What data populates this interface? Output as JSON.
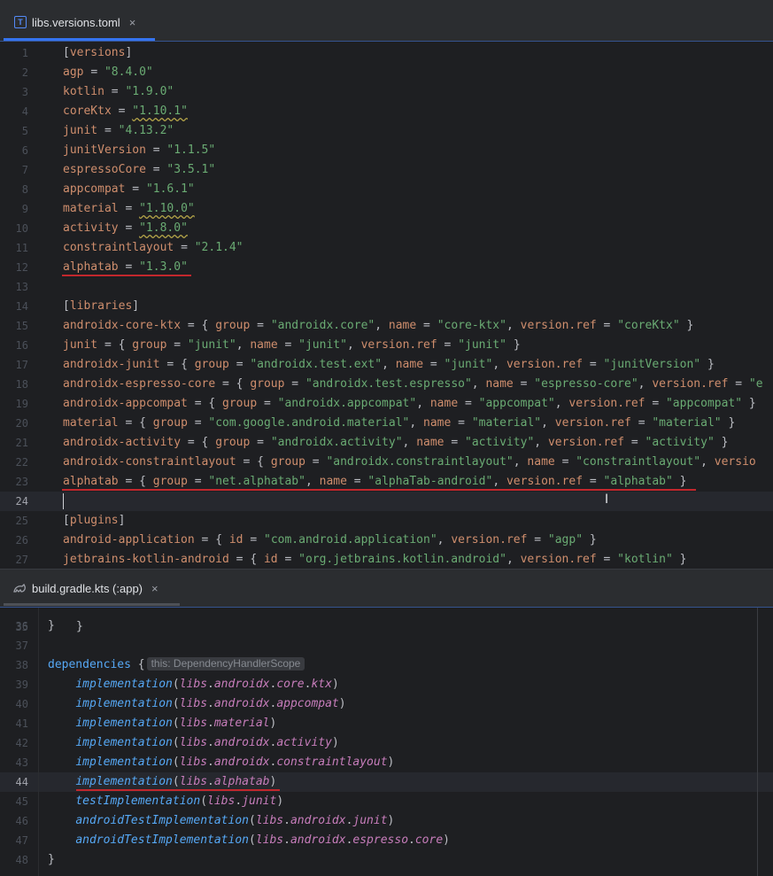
{
  "top_tab": {
    "label": "libs.versions.toml",
    "icon": "toml-file-icon",
    "close": "×"
  },
  "bottom_tab": {
    "label": "build.gradle.kts (:app)",
    "icon": "gradle-file-icon",
    "close": "×"
  },
  "toml": {
    "line_numbers": [
      "1",
      "2",
      "3",
      "4",
      "5",
      "6",
      "7",
      "8",
      "9",
      "10",
      "11",
      "12",
      "13",
      "14",
      "15",
      "16",
      "17",
      "18",
      "19",
      "20",
      "21",
      "22",
      "23",
      "24",
      "25",
      "26",
      "27"
    ],
    "lines": [
      "[versions]",
      "agp = \"8.4.0\"",
      "kotlin = \"1.9.0\"",
      "coreKtx = \"1.10.1\"",
      "junit = \"4.13.2\"",
      "junitVersion = \"1.1.5\"",
      "espressoCore = \"3.5.1\"",
      "appcompat = \"1.6.1\"",
      "material = \"1.10.0\"",
      "activity = \"1.8.0\"",
      "constraintlayout = \"2.1.4\"",
      "alphatab = \"1.3.0\"",
      "",
      "[libraries]",
      "androidx-core-ktx = { group = \"androidx.core\", name = \"core-ktx\", version.ref = \"coreKtx\" }",
      "junit = { group = \"junit\", name = \"junit\", version.ref = \"junit\" }",
      "androidx-junit = { group = \"androidx.test.ext\", name = \"junit\", version.ref = \"junitVersion\" }",
      "androidx-espresso-core = { group = \"androidx.test.espresso\", name = \"espresso-core\", version.ref = \"e",
      "androidx-appcompat = { group = \"androidx.appcompat\", name = \"appcompat\", version.ref = \"appcompat\" }",
      "material = { group = \"com.google.android.material\", name = \"material\", version.ref = \"material\" }",
      "androidx-activity = { group = \"androidx.activity\", name = \"activity\", version.ref = \"activity\" }",
      "androidx-constraintlayout = { group = \"androidx.constraintlayout\", name = \"constraintlayout\", versio",
      "alphatab = { group = \"net.alphatab\", name = \"alphaTab-android\", version.ref = \"alphatab\" }",
      "",
      "[plugins]",
      "android-application = { id = \"com.android.application\", version.ref = \"agp\" }",
      "jetbrains-kotlin-android = { id = \"org.jetbrains.kotlin.android\", version.ref = \"kotlin\" }"
    ],
    "current_line_index": 23
  },
  "gradle": {
    "line_numbers": [
      "36",
      "37",
      "38",
      "39",
      "40",
      "41",
      "42",
      "43",
      "44",
      "45",
      "46",
      "47",
      "48"
    ],
    "lines": [
      "}",
      "",
      "dependencies {",
      "    implementation(libs.androidx.core.ktx)",
      "    implementation(libs.androidx.appcompat)",
      "    implementation(libs.material)",
      "    implementation(libs.androidx.activity)",
      "    implementation(libs.androidx.constraintlayout)",
      "    implementation(libs.alphatab)",
      "    testImplementation(libs.junit)",
      "    androidTestImplementation(libs.androidx.junit)",
      "    androidTestImplementation(libs.androidx.espresso.core)",
      "}"
    ],
    "inlay_hint": "this: DependencyHandlerScope",
    "current_line_index": 8
  },
  "colors": {
    "background": "#1e1f22",
    "keyword": "#cf8e6d",
    "string": "#6aab73",
    "function": "#56a8f5",
    "property": "#c77dbb",
    "error_underline": "#c2272d",
    "accent": "#3574f0"
  }
}
